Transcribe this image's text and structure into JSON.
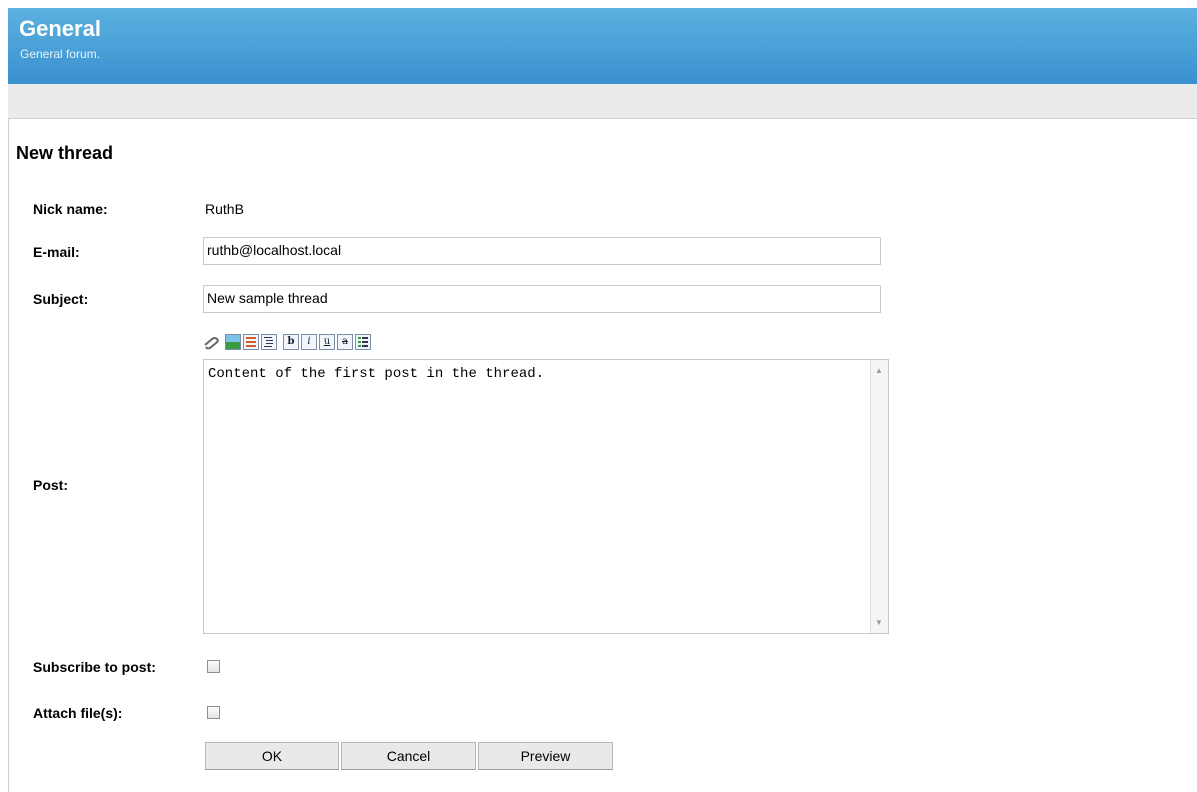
{
  "header": {
    "title": "General",
    "subtitle": "General forum."
  },
  "form": {
    "title": "New thread",
    "nickname_label": "Nick name:",
    "nickname_value": "RuthB",
    "email_label": "E-mail:",
    "email_value": "ruthb@localhost.local",
    "subject_label": "Subject:",
    "subject_value": "New sample thread",
    "post_label": "Post:",
    "post_value": "Content of the first post in the thread.",
    "subscribe_label": "Subscribe to post:",
    "attach_label": "Attach file(s):"
  },
  "toolbar": {
    "bold": "b",
    "italic": "i",
    "underline": "u",
    "strike": "a"
  },
  "buttons": {
    "ok": "OK",
    "cancel": "Cancel",
    "preview": "Preview"
  }
}
